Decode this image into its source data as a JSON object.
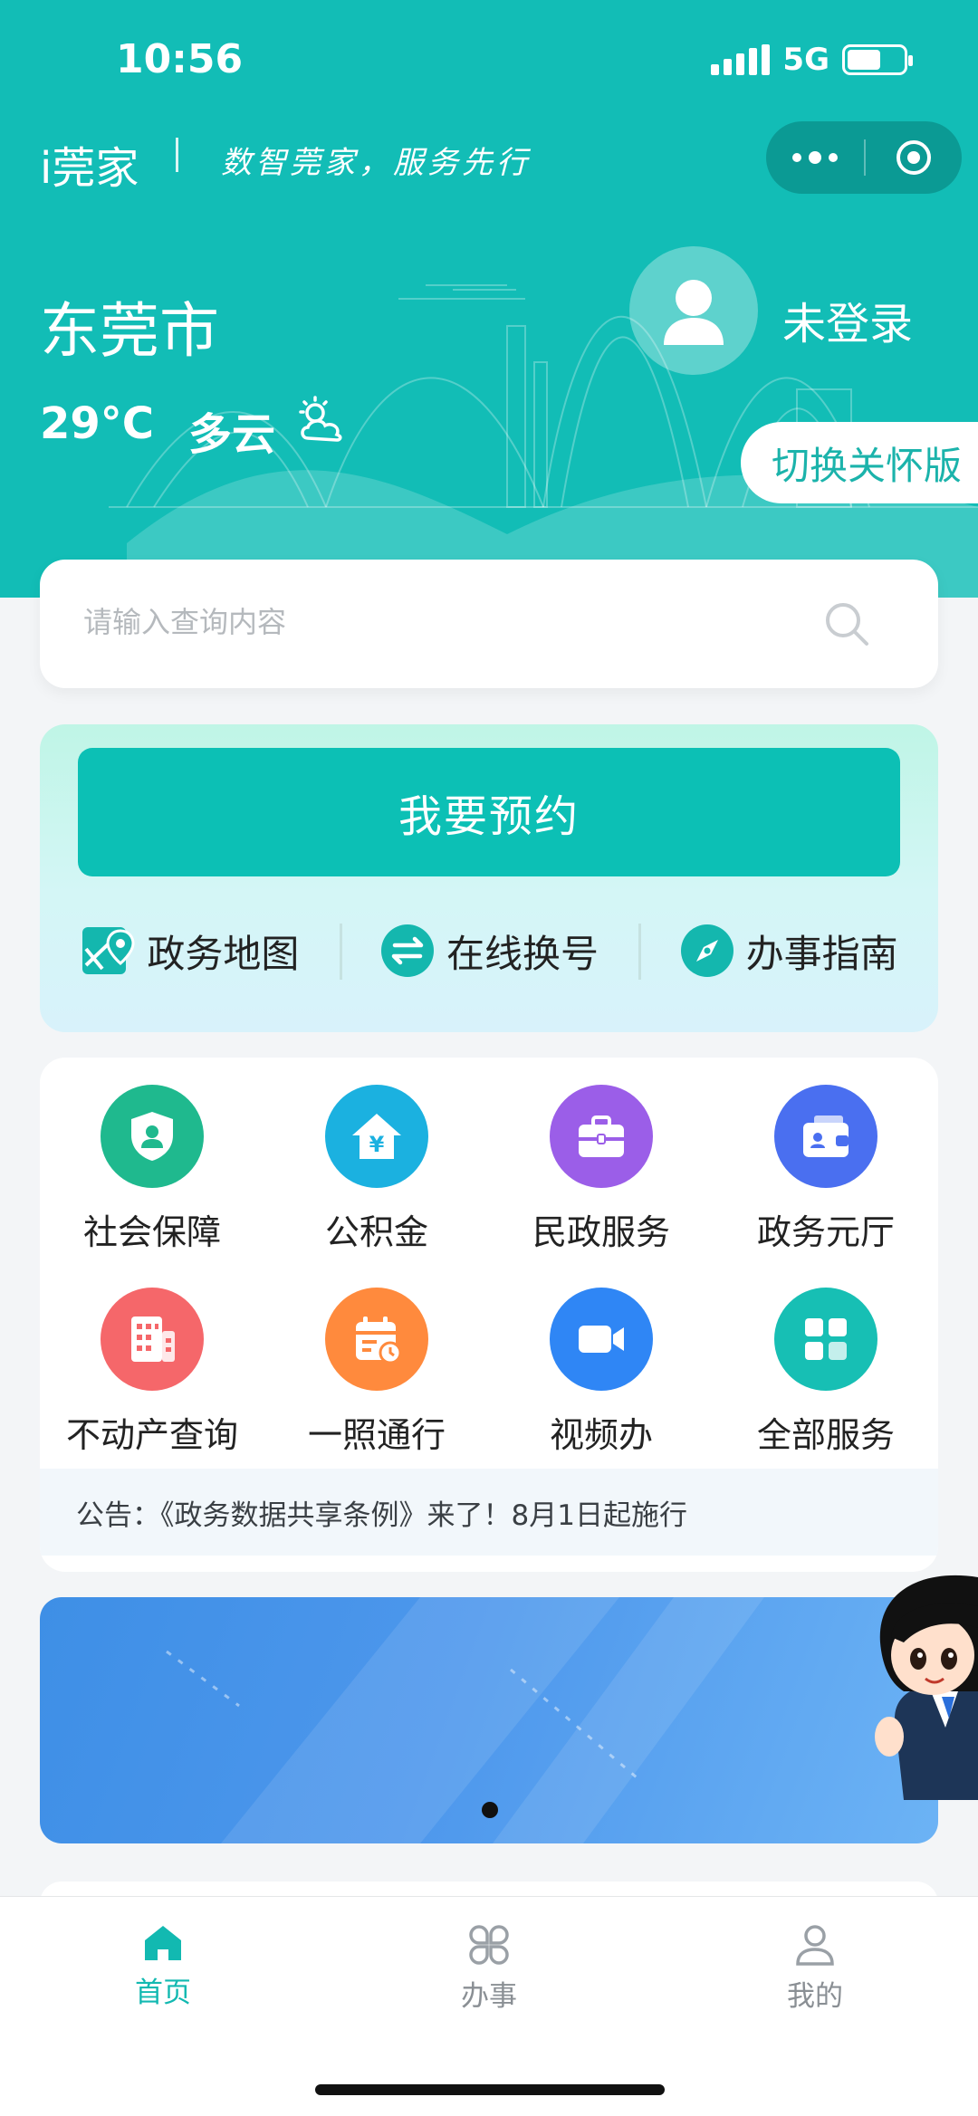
{
  "status_bar": {
    "time": "10:56",
    "network": "5G"
  },
  "header": {
    "app_title": "i莞家",
    "slogan": "数智莞家，服务先行",
    "city": "东莞市",
    "temperature": "29°C",
    "weather": "多云",
    "login_status": "未登录",
    "care_mode_button": "切换关怀版"
  },
  "search": {
    "placeholder": "请输入查询内容"
  },
  "appointment": {
    "button_label": "我要预约",
    "quick_links": [
      {
        "label": "政务地图",
        "icon": "map-icon"
      },
      {
        "label": "在线换号",
        "icon": "swap-icon"
      },
      {
        "label": "办事指南",
        "icon": "compass-icon"
      }
    ]
  },
  "services": [
    {
      "label": "社会保障",
      "icon": "shield-person-icon",
      "color": "#1fb98e"
    },
    {
      "label": "公积金",
      "icon": "house-yuan-icon",
      "color": "#1bb1e0"
    },
    {
      "label": "民政服务",
      "icon": "briefcase-icon",
      "color": "#9b5ee8"
    },
    {
      "label": "政务元厅",
      "icon": "wallet-card-icon",
      "color": "#4a6ff0"
    },
    {
      "label": "不动产查询",
      "icon": "building-icon",
      "color": "#f5676a"
    },
    {
      "label": "一照通行",
      "icon": "calendar-clock-icon",
      "color": "#ff8a3d"
    },
    {
      "label": "视频办",
      "icon": "video-camera-icon",
      "color": "#2f86f5"
    },
    {
      "label": "全部服务",
      "icon": "grid-apps-icon",
      "color": "#17bfb4"
    }
  ],
  "notice": {
    "text": "公告：《政务数据共享条例》来了！8月1日起施行"
  },
  "tabbar": {
    "items": [
      {
        "label": "首页",
        "icon": "home-icon",
        "active": true
      },
      {
        "label": "办事",
        "icon": "clover-grid-icon",
        "active": false
      },
      {
        "label": "我的",
        "icon": "person-icon",
        "active": false
      }
    ]
  },
  "colors": {
    "brand": "#12bdb6",
    "accent_button": "#0cc0b5"
  }
}
